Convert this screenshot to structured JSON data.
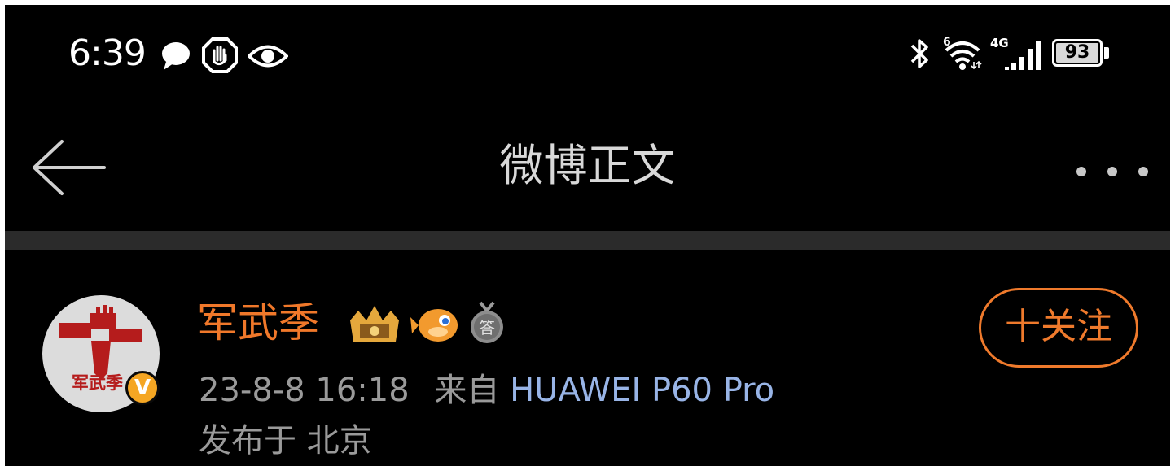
{
  "status_bar": {
    "time": "6:39",
    "icons": [
      "message-icon",
      "hand-stop-icon",
      "eye-icon",
      "bluetooth-icon",
      "wifi-icon",
      "cellular-4g-icon",
      "battery-icon"
    ],
    "wifi_label": "6",
    "network_label": "4G",
    "battery_level": "93"
  },
  "nav": {
    "title": "微博正文"
  },
  "post": {
    "author": "军武季",
    "avatar_text": "军武季",
    "badges": [
      "crown-badge-icon",
      "pufferfish-badge-icon",
      "medal-badge-icon"
    ],
    "medal_text": "答",
    "verified_mark": "V",
    "follow_label": "十关注",
    "date": "23-8-8 16:18",
    "from_label": "来自",
    "source": "HUAWEI P60 Pro",
    "location": "发布于 北京"
  },
  "colors": {
    "background": "#000000",
    "accent": "#ef7a2c",
    "username": "#f0782a",
    "source_link": "#98b4e6",
    "meta_text": "#9a9a9a",
    "separator": "#2b2b2b"
  }
}
